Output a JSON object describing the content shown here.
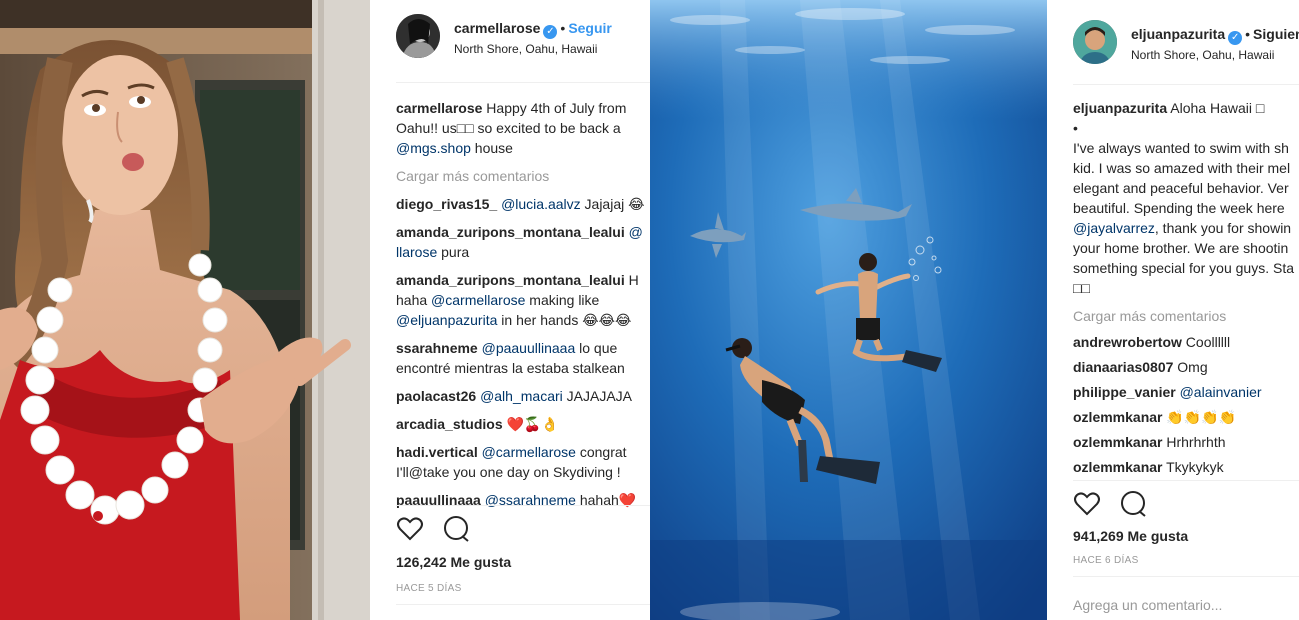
{
  "post1": {
    "username": "carmellarose",
    "follow_label": "Seguir",
    "location": "North Shore, Oahu, Hawaii",
    "caption": {
      "user": "carmellarose",
      "line1": "Happy 4th of July from",
      "line2": "Oahu!! us□□ so excited to be back a",
      "line3_mention": "@mgs.shop",
      "line3_rest": " house"
    },
    "load_more": "Cargar más comentarios",
    "comments": [
      {
        "user": "diego_rivas15_",
        "mention": "@lucia.aalvz",
        "text": " Jajajaj 😂"
      },
      {
        "user": "amanda_zuripons_montana_lealui",
        "mention": "@",
        "line2_mention": "llarose",
        "line2": " pura"
      },
      {
        "user": "amanda_zuripons_montana_lealui",
        "text": " H",
        "line2": "haha ",
        "line2_mention": "@carmellarose",
        "line2_rest": " making like",
        "line3_mention": "@eljuanpazurita",
        "line3": " in her hands 😂😂😂"
      },
      {
        "user": "ssarahneme",
        "mention": "@paauullinaaa",
        "text": " lo que",
        "line2": "encontré mientras la estaba stalkean"
      },
      {
        "user": "paolacast26",
        "mention": "@alh_macari",
        "text": " JAJAJAJA"
      },
      {
        "user": "arcadia_studios",
        "text": " ❤️🍒👌"
      },
      {
        "user": "hadi.vertical",
        "mention": "@carmellarose",
        "text": " congrat",
        "line2": "I'll@take you one day on Skydiving !"
      },
      {
        "user": "paauullinaaa",
        "mention": "@ssarahneme",
        "text": " hahah❤️"
      }
    ],
    "likes": "126,242 Me gusta",
    "time": "HACE 5 DÍAS"
  },
  "post2": {
    "username": "eljuanpazurita",
    "follow_label": "Siguien",
    "location": "North Shore, Oahu, Hawaii",
    "caption": {
      "user": "eljuanpazurita",
      "line1": "Aloha Hawaii □",
      "line2": "•",
      "line3": "I've always wanted to swim with sh",
      "line4": "kid. I was so amazed with their mel",
      "line5": "elegant and peaceful behavior. Ver",
      "line6": "beautiful. Spending the week here",
      "line7_mention": "@jayalvarrez",
      "line7": ", thank you for showin",
      "line8": "your home brother. We are shootin",
      "line9": "something special for you guys. Sta",
      "line10": "□□"
    },
    "load_more": "Cargar más comentarios",
    "comments": [
      {
        "user": "andrewrobertow",
        "text": " Coollllll"
      },
      {
        "user": "dianaarias0807",
        "text": " Omg"
      },
      {
        "user": "philippe_vanier",
        "mention": "@alainvanier"
      },
      {
        "user": "ozlemmkanar",
        "text": " 👏👏👏👏"
      },
      {
        "user": "ozlemmkanar",
        "text": " Hrhrhrhth"
      },
      {
        "user": "ozlemmkanar",
        "text": " Tkykykyk"
      }
    ],
    "likes": "941,269 Me gusta",
    "time": "HACE 6 DÍAS",
    "add_comment_placeholder": "Agrega un comentario..."
  },
  "icons": [
    "heart-icon",
    "comment-icon",
    "verified-icon"
  ],
  "colors": {
    "link": "#003569",
    "follow": "#3897f0",
    "muted": "#999999",
    "text": "#262626",
    "ocean": "#1c64a8"
  }
}
